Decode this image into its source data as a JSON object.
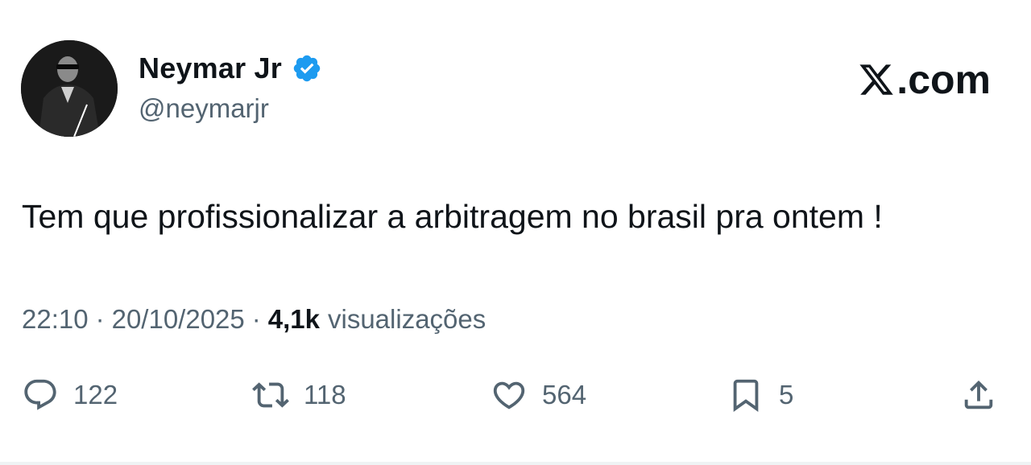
{
  "author": {
    "display_name": "Neymar Jr",
    "handle": "@neymarjr",
    "verified_icon": "verified-badge-icon",
    "verified_color": "#1d9bf0"
  },
  "brand": {
    "label": ".com",
    "icon": "x-logo-icon"
  },
  "tweet": {
    "text": "Tem que profissionalizar a arbitragem no brasil pra ontem !"
  },
  "meta": {
    "time": "22:10",
    "separator": "·",
    "date": "20/10/2025",
    "views_count": "4,1k",
    "views_label": "visualizações"
  },
  "actions": {
    "reply": {
      "icon": "reply-icon",
      "count": "122"
    },
    "retweet": {
      "icon": "retweet-icon",
      "count": "118"
    },
    "like": {
      "icon": "heart-icon",
      "count": "564"
    },
    "bookmark": {
      "icon": "bookmark-icon",
      "count": "5"
    },
    "share": {
      "icon": "share-icon"
    }
  },
  "colors": {
    "text_primary": "#0f1419",
    "text_secondary": "#536471",
    "background": "#ffffff"
  }
}
